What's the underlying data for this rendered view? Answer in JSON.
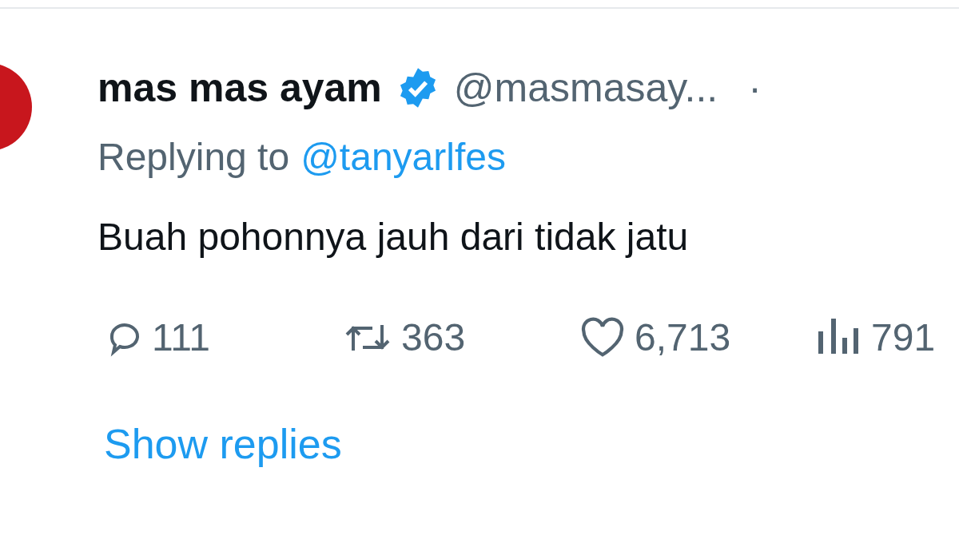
{
  "author": {
    "name": "mas mas ayam",
    "verified": true,
    "handle": "@masmasay...",
    "separator": "·"
  },
  "reply_context": {
    "label": "Replying to",
    "mention": "@tanyarlfes"
  },
  "text": "Buah pohonnya jauh dari tidak jatu",
  "stats": [
    {
      "kind": "reply",
      "count": "111"
    },
    {
      "kind": "repost",
      "count": "363"
    },
    {
      "kind": "like",
      "count": "6,713"
    },
    {
      "kind": "views",
      "count": "791"
    }
  ],
  "show_replies": "Show replies"
}
